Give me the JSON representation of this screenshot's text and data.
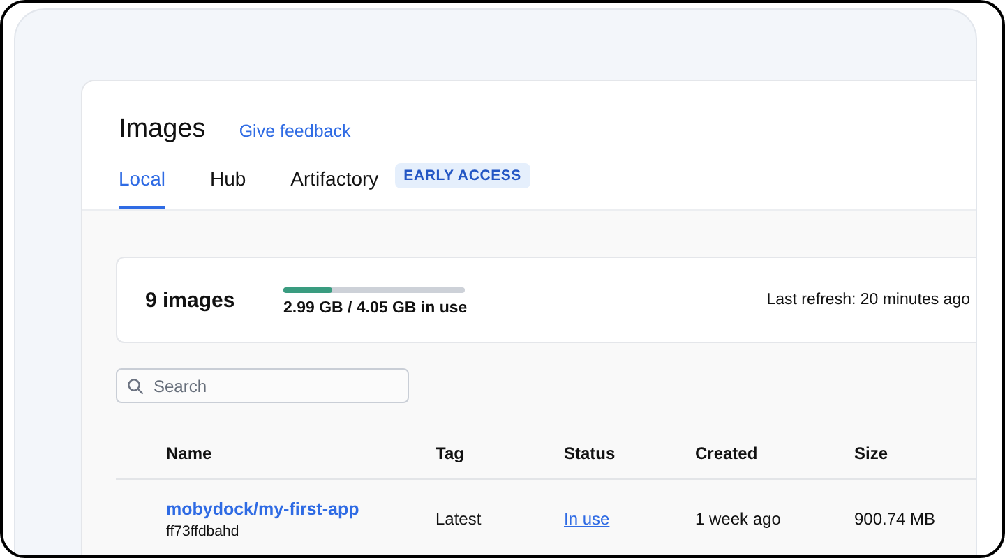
{
  "header": {
    "title": "Images",
    "feedback_link": "Give feedback"
  },
  "tabs": [
    {
      "label": "Local",
      "selected": true
    },
    {
      "label": "Hub",
      "selected": false
    },
    {
      "label": "Artifactory",
      "selected": false,
      "badge": "EARLY ACCESS"
    }
  ],
  "summary": {
    "count": "9 images",
    "usage": {
      "level": 0.27,
      "reading": "2.99 GB / 4.05 GB in use"
    },
    "last_refresh": "Last refresh: 20 minutes ago"
  },
  "search": {
    "placeholder": "Search"
  },
  "table": {
    "columns": [
      "Name",
      "Tag",
      "Status",
      "Created",
      "Size"
    ],
    "rows": [
      {
        "name": "mobydock/my-first-app",
        "id": "ff73ffdbahd",
        "tag": "Latest",
        "status": "In use",
        "created": "1 week ago",
        "size": "900.74 MB"
      }
    ]
  }
}
